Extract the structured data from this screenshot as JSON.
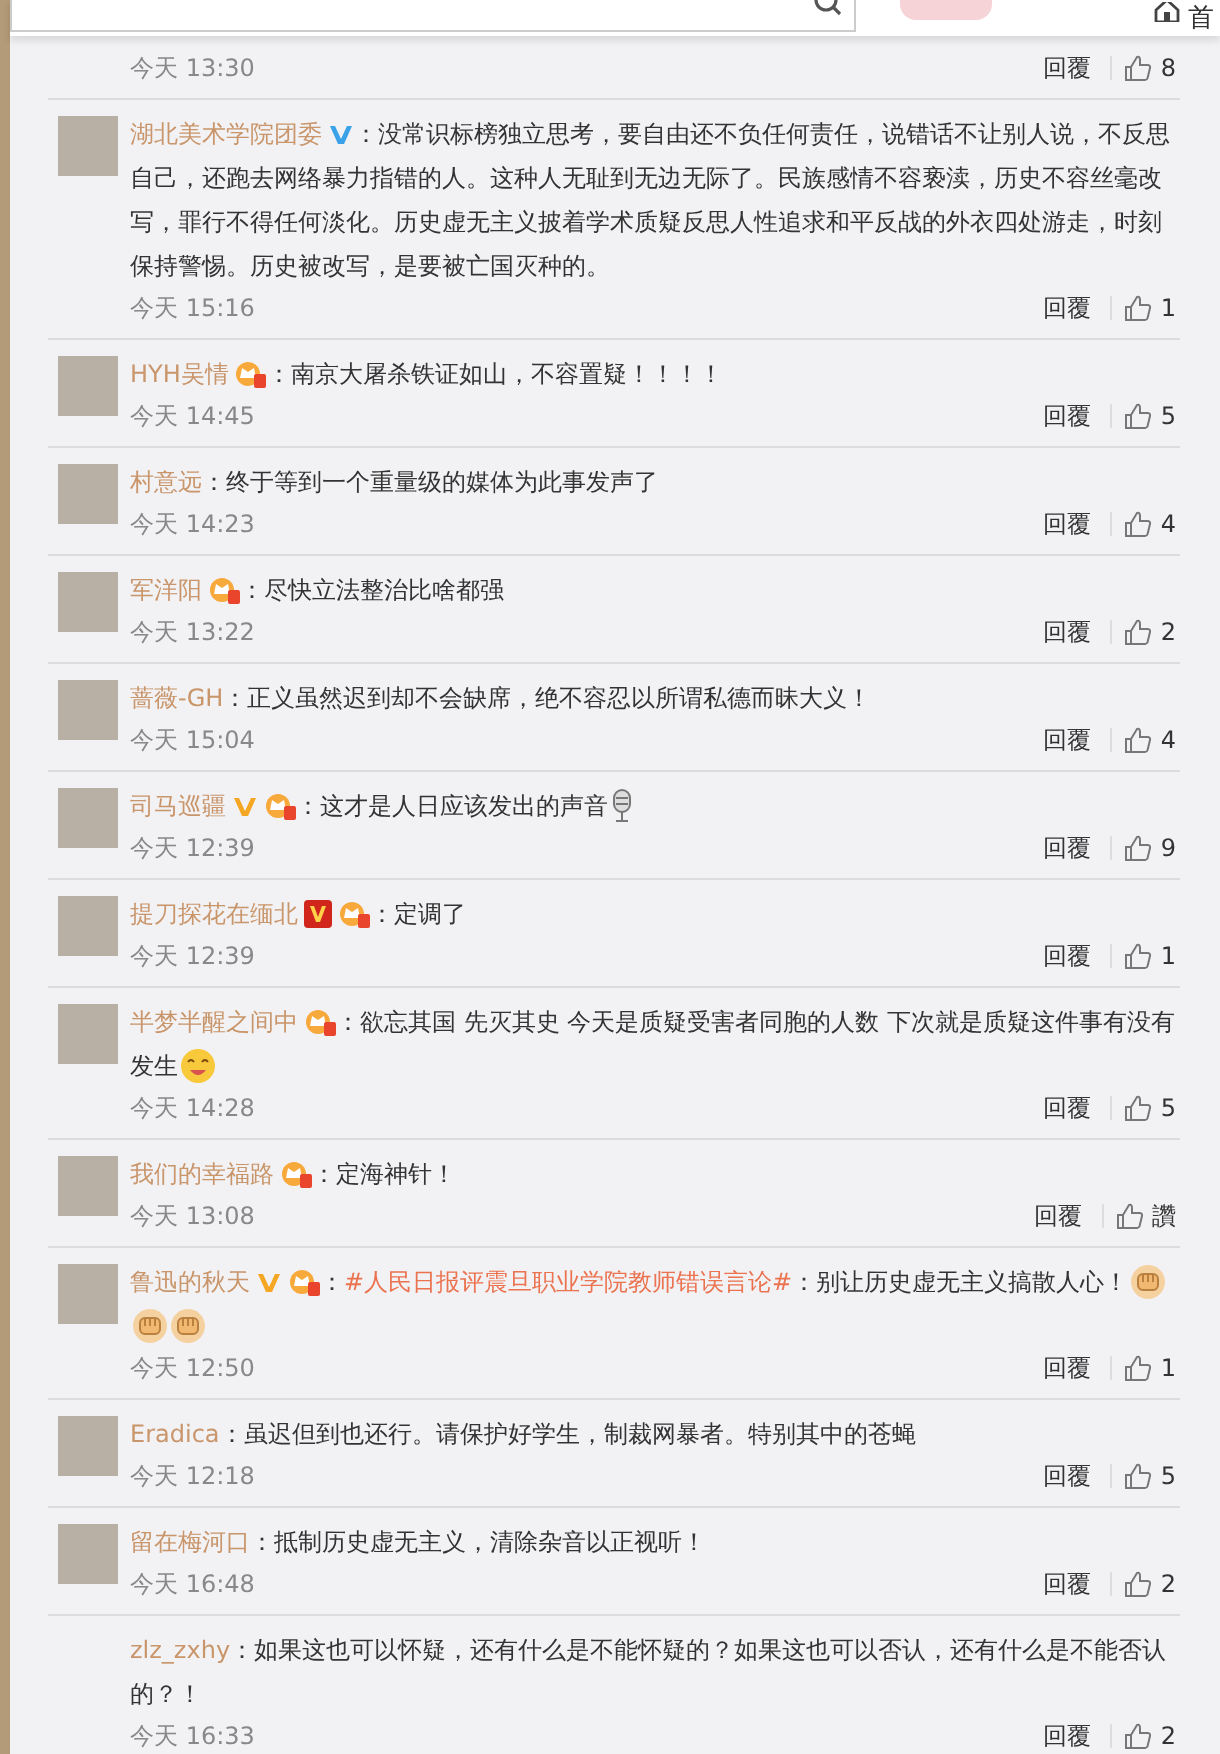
{
  "header": {
    "home_label": "首"
  },
  "comments": [
    {
      "avatar": false,
      "time": "今天 13:30",
      "reply": "回覆",
      "likes": "8"
    },
    {
      "avatar": true,
      "user": "湖北美术学院团委",
      "badges": [
        {
          "kind": "verified-blue"
        }
      ],
      "parts": [
        {
          "kind": "text",
          "text": "：没常识标榜独立思考，要自由还不负任何责任，说错话不让别人说，不反思自己，还跑去网络暴力指错的人。这种人无耻到无边无际了。民族感情不容亵渎，历史不容丝毫改写，罪行不得任何淡化。历史虚无主义披着学术质疑反思人性追求和平反战的外衣四处游走，时刻保持警惕。历史被改写，是要被亡国灭种的。"
        }
      ],
      "time": "今天 15:16",
      "reply": "回覆",
      "likes": "1"
    },
    {
      "avatar": true,
      "user": "HYH吴情",
      "badges": [
        {
          "kind": "level"
        }
      ],
      "parts": [
        {
          "kind": "text",
          "text": "：南京大屠杀铁证如山，不容置疑！！！！"
        }
      ],
      "time": "今天 14:45",
      "reply": "回覆",
      "likes": "5"
    },
    {
      "avatar": true,
      "user": "村意远",
      "parts": [
        {
          "kind": "text",
          "text": "：终于等到一个重量级的媒体为此事发声了"
        }
      ],
      "time": "今天 14:23",
      "reply": "回覆",
      "likes": "4"
    },
    {
      "avatar": true,
      "user": "军洋阳",
      "badges": [
        {
          "kind": "level"
        }
      ],
      "parts": [
        {
          "kind": "text",
          "text": "：尽快立法整治比啥都强"
        }
      ],
      "time": "今天 13:22",
      "reply": "回覆",
      "likes": "2"
    },
    {
      "avatar": true,
      "user": "蔷薇-GH",
      "parts": [
        {
          "kind": "text",
          "text": "：正义虽然迟到却不会缺席，绝不容忍以所谓私德而昧大义！"
        }
      ],
      "time": "今天 15:04",
      "reply": "回覆",
      "likes": "4"
    },
    {
      "avatar": true,
      "user": "司马巡疆",
      "badges": [
        {
          "kind": "verified-gold"
        },
        {
          "kind": "level"
        }
      ],
      "parts": [
        {
          "kind": "text",
          "text": "：这才是人日应该发出的声音"
        }
      ],
      "emoji": [
        {
          "kind": "microphone"
        }
      ],
      "time": "今天 12:39",
      "reply": "回覆",
      "likes": "9"
    },
    {
      "avatar": true,
      "user": "提刀探花在缅北",
      "badges": [
        {
          "kind": "verified-red"
        },
        {
          "kind": "level"
        }
      ],
      "parts": [
        {
          "kind": "text",
          "text": "：定调了"
        }
      ],
      "time": "今天 12:39",
      "reply": "回覆",
      "likes": "1"
    },
    {
      "avatar": true,
      "user": "半梦半醒之间中",
      "badges": [
        {
          "kind": "level"
        }
      ],
      "parts": [
        {
          "kind": "text",
          "text": "：欲忘其国 先灭其史 今天是质疑受害者同胞的人数 下次就是质疑这件事有没有发生"
        }
      ],
      "emoji": [
        {
          "kind": "smiley"
        }
      ],
      "time": "今天 14:28",
      "reply": "回覆",
      "likes": "5"
    },
    {
      "avatar": true,
      "user": "我们的幸福路",
      "badges": [
        {
          "kind": "level"
        }
      ],
      "parts": [
        {
          "kind": "text",
          "text": "：定海神针！"
        }
      ],
      "time": "今天 13:08",
      "reply": "回覆",
      "likes": "讚"
    },
    {
      "avatar": true,
      "user": "鲁迅的秋天",
      "badges": [
        {
          "kind": "verified-gold"
        },
        {
          "kind": "level"
        }
      ],
      "parts": [
        {
          "kind": "text",
          "text": "："
        },
        {
          "kind": "topic",
          "text": "#人民日报评震旦职业学院教师错误言论#"
        },
        {
          "kind": "text",
          "text": "：别让历史虚无主义搞散人心！"
        }
      ],
      "emoji": [
        {
          "kind": "fist"
        },
        {
          "kind": "fist"
        },
        {
          "kind": "fist"
        }
      ],
      "time": "今天 12:50",
      "reply": "回覆",
      "likes": "1"
    },
    {
      "avatar": true,
      "user": "Eradica",
      "parts": [
        {
          "kind": "text",
          "text": "：虽迟但到也还行。请保护好学生，制裁网暴者。特别其中的苍蝇"
        }
      ],
      "time": "今天 12:18",
      "reply": "回覆",
      "likes": "5"
    },
    {
      "avatar": true,
      "user": "留在梅河口",
      "parts": [
        {
          "kind": "text",
          "text": "：抵制历史虚无主义，清除杂音以正视听！"
        }
      ],
      "time": "今天 16:48",
      "reply": "回覆",
      "likes": "2"
    },
    {
      "avatar": false,
      "user": "zlz_zxhy",
      "parts": [
        {
          "kind": "text",
          "text": "：如果这也可以怀疑，还有什么是不能怀疑的？如果这也可以否认，还有什么是不能否认的？！"
        }
      ],
      "time": "今天 16:33",
      "reply": "回覆",
      "likes": "2"
    }
  ]
}
